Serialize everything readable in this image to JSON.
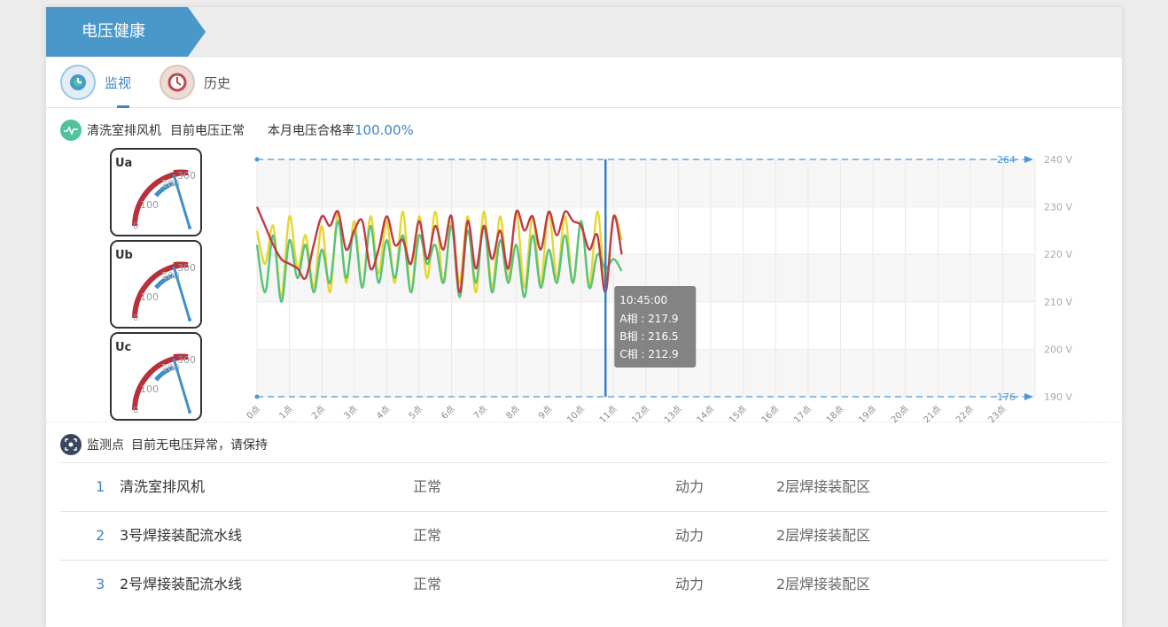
{
  "header": {
    "title": "电压健康"
  },
  "tabs": [
    {
      "label": "监视",
      "icon": "monitor-icon",
      "active": true
    },
    {
      "label": "历史",
      "icon": "clock-icon",
      "active": false
    }
  ],
  "status": {
    "device": "清洗室排风机",
    "state": "目前电压正常",
    "rate_label": "本月电压合格率",
    "rate_value": "100.00%"
  },
  "gauges": [
    {
      "name": "Ua",
      "color": "#e8d84a",
      "scale": [
        "0",
        "100",
        "200",
        "300"
      ]
    },
    {
      "name": "Ub",
      "color": "#6cc48a",
      "scale": [
        "0",
        "100",
        "200",
        "300"
      ]
    },
    {
      "name": "Uc",
      "color": "#c6474f",
      "scale": [
        "0",
        "100",
        "200",
        "300"
      ]
    }
  ],
  "monitor_points": {
    "title": "监测点",
    "message": "目前无电压异常，请保持",
    "rows": [
      {
        "index": "1",
        "name": "清洗室排风机",
        "status": "正常",
        "type": "动力",
        "location": "2层焊接装配区"
      },
      {
        "index": "2",
        "name": "3号焊接装配流水线",
        "status": "正常",
        "type": "动力",
        "location": "2层焊接装配区"
      },
      {
        "index": "3",
        "name": "2号焊接装配流水线",
        "status": "正常",
        "type": "动力",
        "location": "2层焊接装配区"
      }
    ]
  },
  "chart_data": {
    "type": "line",
    "x_categories": [
      "0点",
      "1点",
      "2点",
      "3点",
      "4点",
      "5点",
      "6点",
      "7点",
      "8点",
      "9点",
      "10点",
      "11点",
      "12点",
      "13点",
      "14点",
      "15点",
      "16点",
      "17点",
      "18点",
      "19点",
      "20点",
      "21点",
      "22点",
      "23点"
    ],
    "y_ticks": [
      "190 V",
      "200 V",
      "210 V",
      "220 V",
      "230 V",
      "240 V"
    ],
    "ylim": [
      190,
      240
    ],
    "limit_lines": [
      {
        "label": "264",
        "value": 240
      },
      {
        "label": "176",
        "value": 190
      }
    ],
    "series": [
      {
        "name": "A相",
        "color": "#e8d62f",
        "x": [
          0,
          0.25,
          0.5,
          0.75,
          1,
          1.25,
          1.5,
          1.75,
          2,
          2.25,
          2.5,
          2.75,
          3,
          3.25,
          3.5,
          3.75,
          4,
          4.25,
          4.5,
          4.75,
          5,
          5.25,
          5.5,
          5.75,
          6,
          6.25,
          6.5,
          6.75,
          7,
          7.25,
          7.5,
          7.75,
          8,
          8.25,
          8.5,
          8.75,
          9,
          9.25,
          9.5,
          9.75,
          10,
          10.25,
          10.5,
          10.75,
          11,
          11.25
        ],
        "values": [
          225,
          218,
          226,
          211,
          228,
          217,
          224,
          213,
          226,
          212,
          229,
          214,
          227,
          213,
          228,
          216,
          227,
          214,
          229,
          212,
          228,
          215,
          229,
          214,
          227,
          214,
          228,
          212,
          229,
          213,
          228,
          215,
          229,
          213,
          228,
          214,
          229,
          215,
          228,
          214,
          227,
          213,
          229,
          214,
          228,
          223
        ]
      },
      {
        "name": "B相",
        "color": "#58c27a",
        "x": [
          0,
          0.25,
          0.5,
          0.75,
          1,
          1.25,
          1.5,
          1.75,
          2,
          2.25,
          2.5,
          2.75,
          3,
          3.25,
          3.5,
          3.75,
          4,
          4.25,
          4.5,
          4.75,
          5,
          5.25,
          5.5,
          5.75,
          6,
          6.25,
          6.5,
          6.75,
          7,
          7.25,
          7.5,
          7.75,
          8,
          8.25,
          8.5,
          8.75,
          9,
          9.25,
          9.5,
          9.75,
          10,
          10.25,
          10.5,
          10.75,
          11,
          11.25
        ],
        "values": [
          222,
          212,
          224,
          210,
          223,
          215,
          222,
          212,
          221,
          214,
          227,
          215,
          225,
          213,
          226,
          214,
          223,
          215,
          224,
          212,
          224,
          218,
          222,
          214,
          226,
          211,
          225,
          214,
          226,
          212,
          223,
          214,
          222,
          211,
          224,
          213,
          221,
          214,
          224,
          214,
          227,
          213,
          220,
          217,
          219,
          216.5
        ]
      },
      {
        "name": "C相",
        "color": "#c03b44",
        "x": [
          0,
          0.25,
          0.5,
          0.75,
          1,
          1.25,
          1.5,
          1.75,
          2,
          2.25,
          2.5,
          2.75,
          3,
          3.25,
          3.5,
          3.75,
          4,
          4.25,
          4.5,
          4.75,
          5,
          5.25,
          5.5,
          5.75,
          6,
          6.25,
          6.5,
          6.75,
          7,
          7.25,
          7.5,
          7.75,
          8,
          8.25,
          8.5,
          8.75,
          9,
          9.25,
          9.5,
          9.75,
          10,
          10.25,
          10.5,
          10.75,
          11,
          11.25
        ],
        "values": [
          230,
          226,
          222,
          219,
          218,
          217,
          215,
          222,
          228,
          226,
          229,
          221,
          225,
          227,
          217,
          221,
          228,
          222,
          223,
          218,
          227,
          219,
          226,
          221,
          228,
          212,
          227,
          217,
          226,
          219,
          225,
          217,
          229,
          225,
          228,
          221,
          229,
          224,
          229,
          227,
          226,
          221,
          224,
          212,
          228,
          220
        ]
      }
    ],
    "cursor": {
      "time": "10:45:00",
      "x": 10.75,
      "readings": [
        {
          "label": "A相",
          "value": "217.9"
        },
        {
          "label": "B相",
          "value": "216.5"
        },
        {
          "label": "C相",
          "value": "212.9"
        }
      ]
    }
  }
}
